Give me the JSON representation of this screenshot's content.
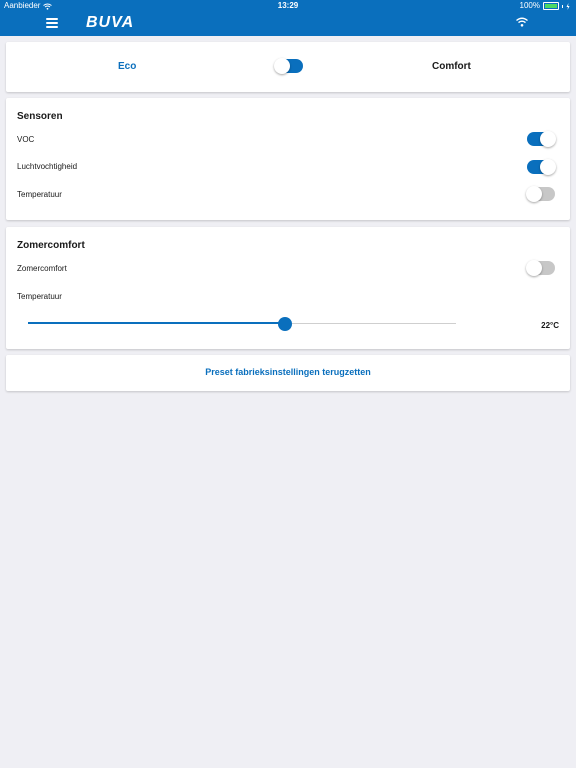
{
  "status_bar": {
    "carrier": "Aanbieder",
    "time": "13:29",
    "battery": "100%"
  },
  "header": {
    "logo": "BUVA"
  },
  "mode": {
    "eco_label": "Eco",
    "comfort_label": "Comfort",
    "toggle_on": true
  },
  "sensors": {
    "title": "Sensoren",
    "items": [
      {
        "label": "VOC",
        "on": true
      },
      {
        "label": "Luchtvochtigheid",
        "on": true
      },
      {
        "label": "Temperatuur",
        "on": false
      }
    ]
  },
  "summer": {
    "title": "Zomercomfort",
    "toggle_label": "Zomercomfort",
    "toggle_on": false,
    "temperature_label": "Temperatuur",
    "temperature_value": "22°C",
    "slider_fraction": 0.6
  },
  "reset": {
    "label": "Preset fabrieksinstellingen terugzetten"
  },
  "colors": {
    "accent": "#0a6fbd",
    "background": "#efeff4",
    "toggle_off": "#c7c7c7"
  }
}
